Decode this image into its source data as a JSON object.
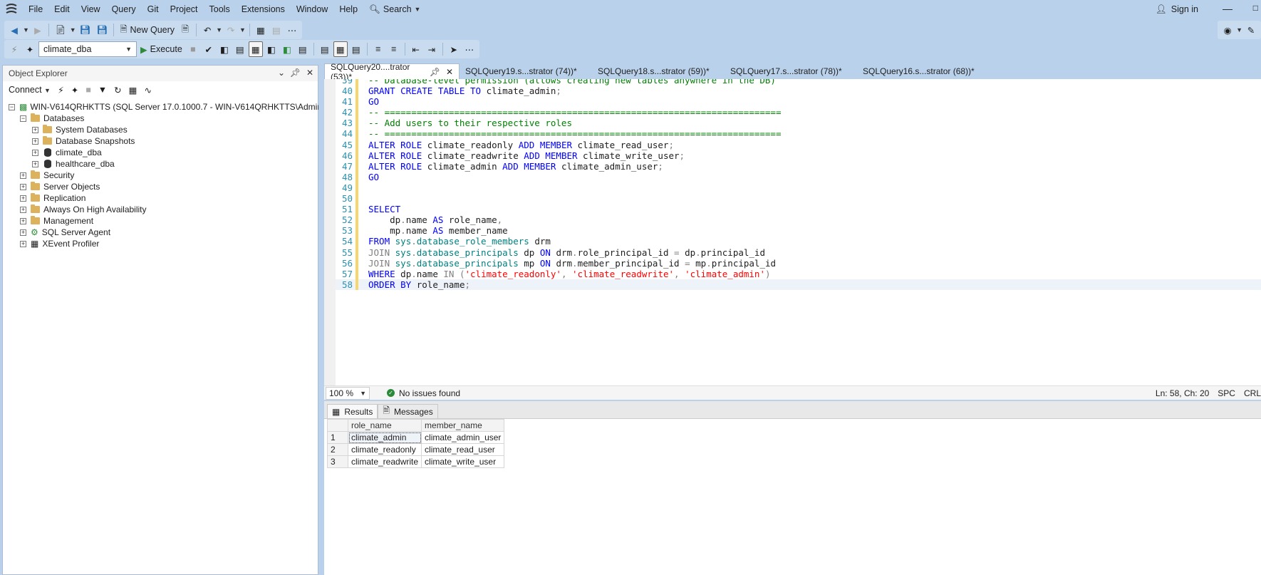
{
  "menu": [
    "File",
    "Edit",
    "View",
    "Query",
    "Git",
    "Project",
    "Tools",
    "Extensions",
    "Window",
    "Help"
  ],
  "search_label": "Search",
  "signin_label": "Sign in",
  "toolbar": {
    "new_query": "New Query",
    "database": "climate_dba",
    "execute": "Execute"
  },
  "object_explorer": {
    "title": "Object Explorer",
    "connect": "Connect",
    "server": "WIN-V614QRHKTTS (SQL Server 17.0.1000.7 - WIN-V614QRHKTTS\\Administrator)",
    "databases": "Databases",
    "system_databases": "System Databases",
    "database_snapshots": "Database Snapshots",
    "db1": "climate_dba",
    "db2": "healthcare_dba",
    "security": "Security",
    "server_objects": "Server Objects",
    "replication": "Replication",
    "always_on": "Always On High Availability",
    "management": "Management",
    "agent": "SQL Server Agent",
    "xevent": "XEvent Profiler"
  },
  "tabs": [
    "SQLQuery20....trator (53))*",
    "SQLQuery19.s...strator (74))*",
    "SQLQuery18.s...strator (59))*",
    "SQLQuery17.s...strator (78))*",
    "SQLQuery16.s...strator (68))*"
  ],
  "line_numbers": [
    "39",
    "40",
    "41",
    "42",
    "43",
    "44",
    "45",
    "46",
    "47",
    "48",
    "49",
    "50",
    "51",
    "52",
    "53",
    "54",
    "55",
    "56",
    "57",
    "58"
  ],
  "code": {
    "l39": "-- Database-level permission (allows creating new tables anywhere in the DB)",
    "l42": "-- ==========================================================================",
    "l43": "-- Add users to their respective roles",
    "l44": "-- =========================================================================="
  },
  "status": {
    "zoom": "100 %",
    "issues": "No issues found",
    "position": "Ln: 58, Ch: 20",
    "spc": "SPC",
    "crlf": "CRL"
  },
  "results": {
    "tab_results": "Results",
    "tab_messages": "Messages",
    "columns": [
      "role_name",
      "member_name"
    ],
    "rows": [
      [
        "1",
        "climate_admin",
        "climate_admin_user"
      ],
      [
        "2",
        "climate_readonly",
        "climate_read_user"
      ],
      [
        "3",
        "climate_readwrite",
        "climate_write_user"
      ]
    ]
  }
}
